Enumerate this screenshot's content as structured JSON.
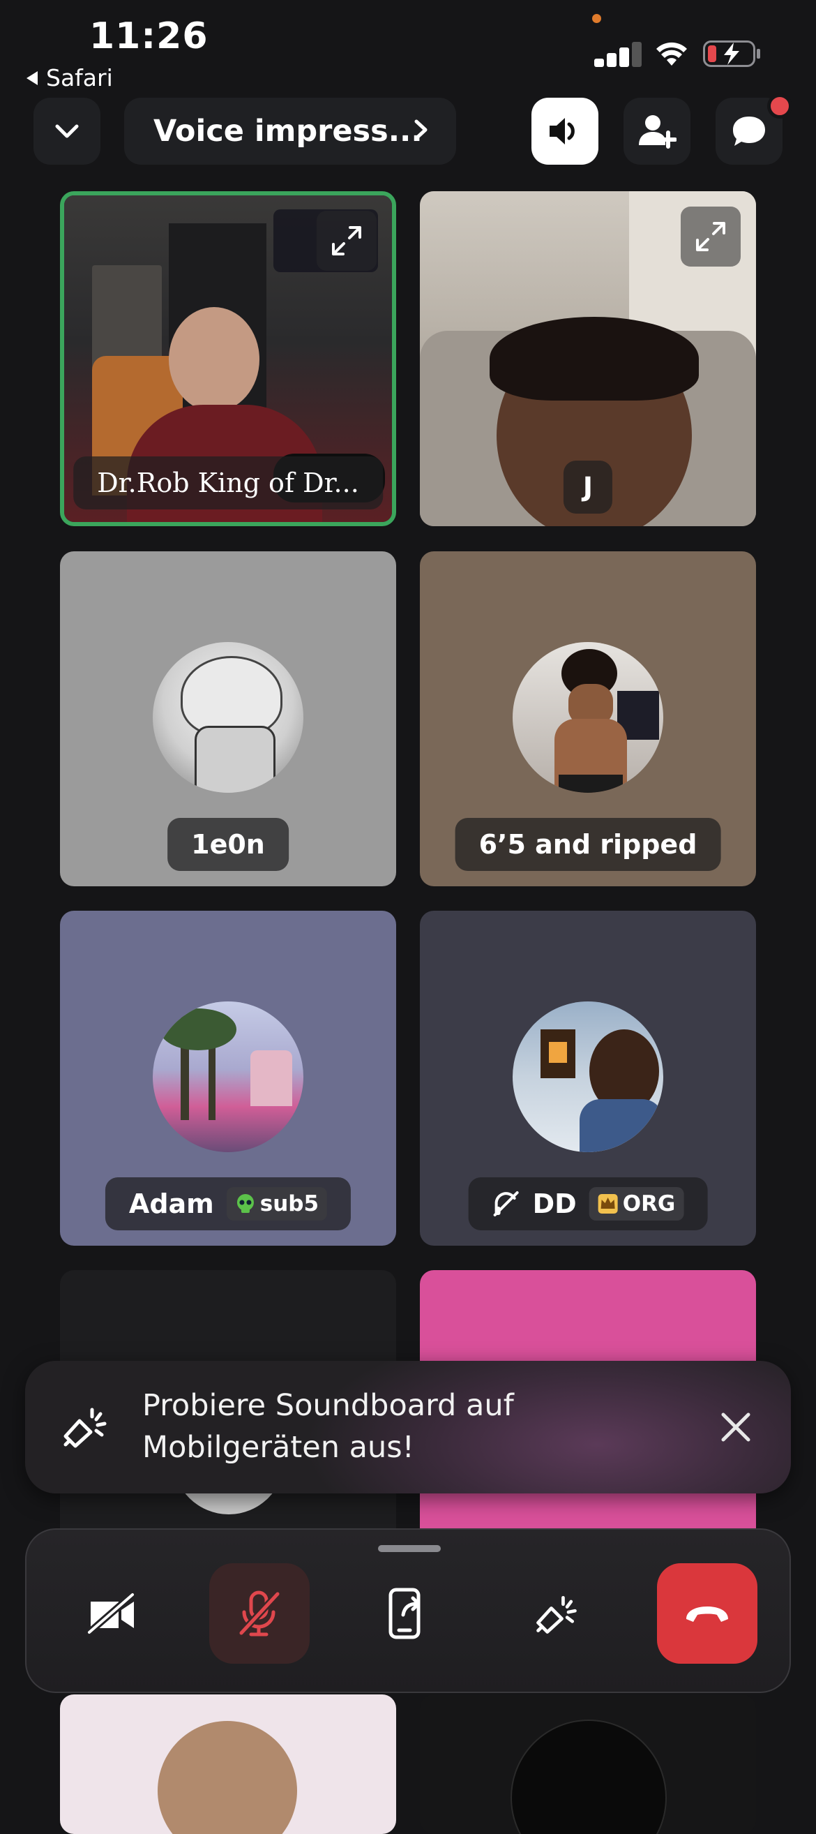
{
  "status_bar": {
    "time": "11:26",
    "back_label": "Safari"
  },
  "header": {
    "channel_title": "Voice impress..."
  },
  "tiles": [
    {
      "name": "Dr.Rob King of Dr...",
      "type": "video"
    },
    {
      "name": "J",
      "type": "video"
    },
    {
      "name": "1e0n",
      "type": "avatar",
      "bg": "#9b9b9b"
    },
    {
      "name": "6’5 and ripped",
      "type": "avatar",
      "bg": "#7a6858"
    },
    {
      "name": "Adam",
      "badge": "sub5",
      "type": "avatar",
      "bg": "#6c6e8f"
    },
    {
      "name": "DD",
      "badge": "ORG",
      "type": "avatar",
      "bg": "#3c3c48"
    }
  ],
  "toast": {
    "message": "Probiere Soundboard auf Mobilgeräten aus!"
  },
  "colors": {
    "speaking_ring": "#3ba55c",
    "hangup": "#da373c",
    "mute_active": "#3a2526",
    "notification": "#e5484d"
  },
  "icons": [
    "chevron-down-icon",
    "chevron-right-icon",
    "speaker-icon",
    "add-user-icon",
    "chat-bubble-icon",
    "expand-icon",
    "muted-icon",
    "soundboard-icon",
    "close-icon",
    "camera-off-icon",
    "microphone-off-icon",
    "screen-share-icon",
    "hang-up-icon"
  ]
}
